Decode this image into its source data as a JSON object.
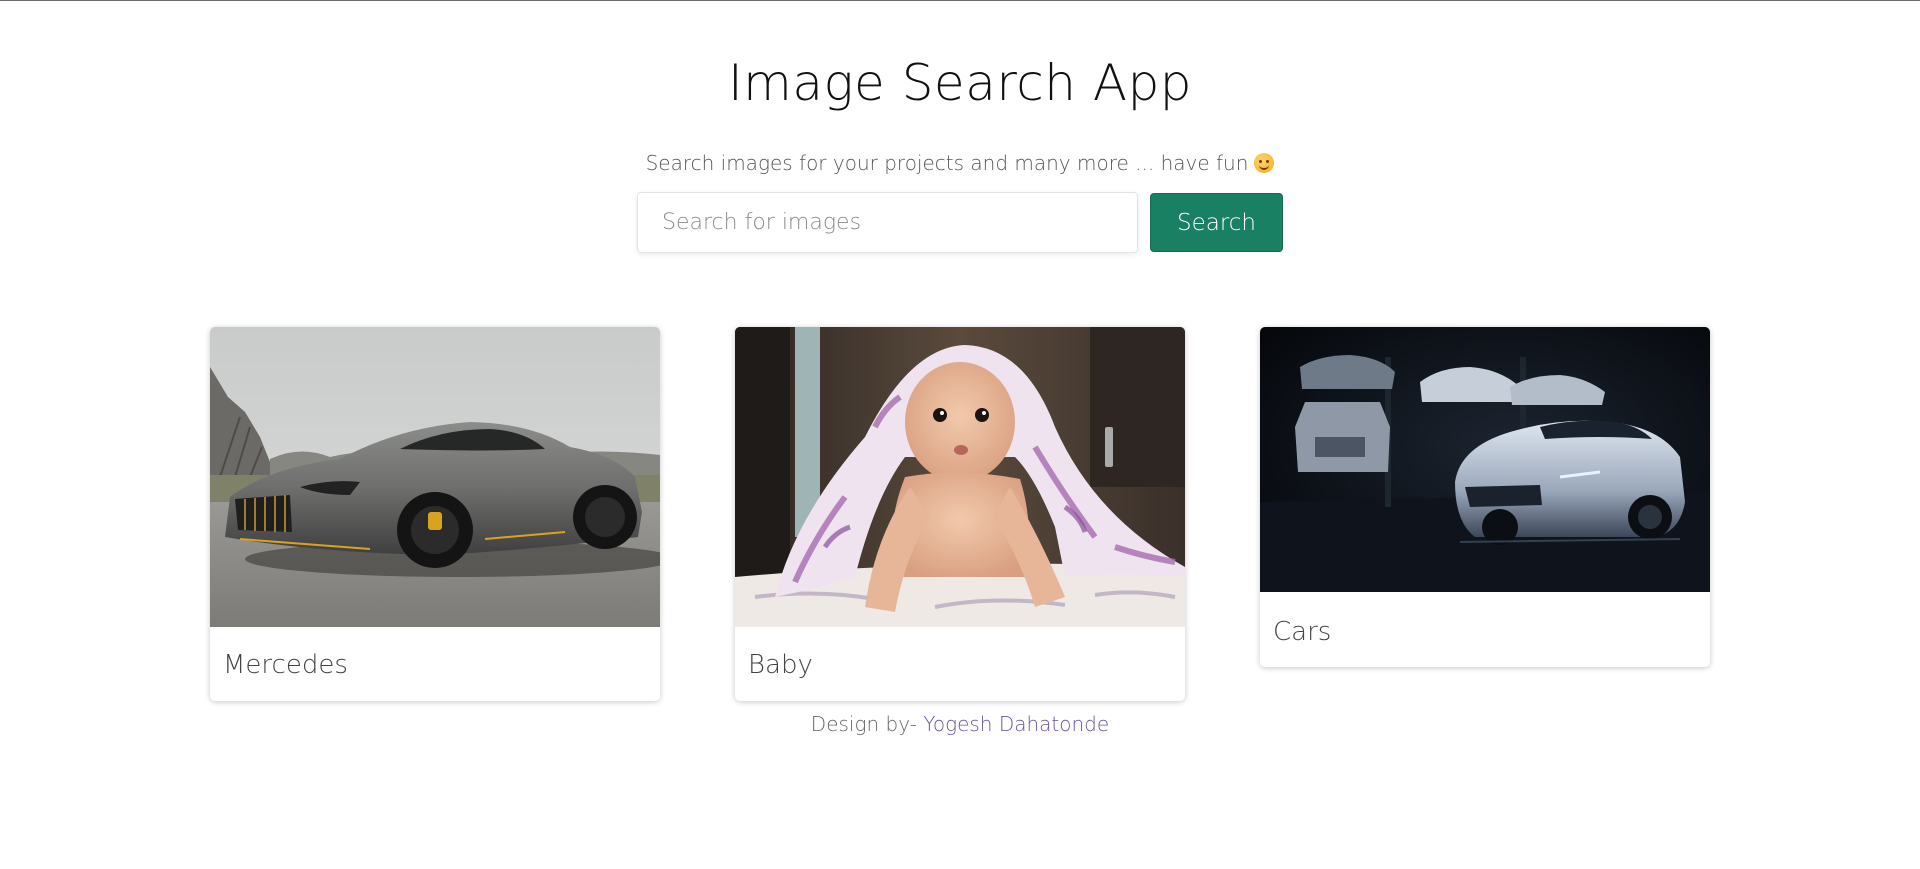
{
  "header": {
    "title": "Image Search App",
    "subtitle": "Search images for your projects and many more ... have fun",
    "emoji_icon": "smiling-face-icon"
  },
  "search": {
    "placeholder": "Search for images",
    "value": "",
    "button_label": "Search",
    "button_color": "#1a8063"
  },
  "results": [
    {
      "label": "Mercedes",
      "image": "grey-sports-car-photo"
    },
    {
      "label": "Baby",
      "image": "baby-under-blanket-photo"
    },
    {
      "label": "Cars",
      "image": "white-cars-in-dark-garage-photo"
    }
  ],
  "footer": {
    "prefix": "Design by-",
    "author": "Yogesh Dahatonde",
    "author_color": "#6a55a0"
  }
}
